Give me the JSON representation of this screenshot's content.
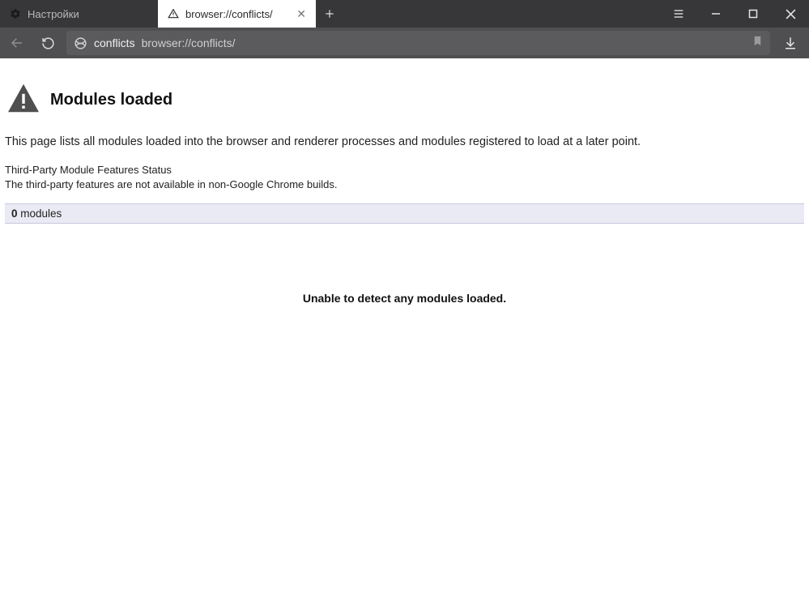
{
  "tabs": [
    {
      "label": "Настройки",
      "active": false
    },
    {
      "label": "browser://conflicts/",
      "active": true
    }
  ],
  "address": {
    "page_name": "conflicts",
    "url": "browser://conflicts/"
  },
  "content": {
    "title": "Modules loaded",
    "description": "This page lists all modules loaded into the browser and renderer processes and modules registered to load at a later point.",
    "third_party_title": "Third-Party Module Features Status",
    "third_party_text": "The third-party features are not available in non-Google Chrome builds.",
    "modules_count": "0",
    "modules_label": " modules",
    "no_modules_msg": "Unable to detect any modules loaded."
  }
}
